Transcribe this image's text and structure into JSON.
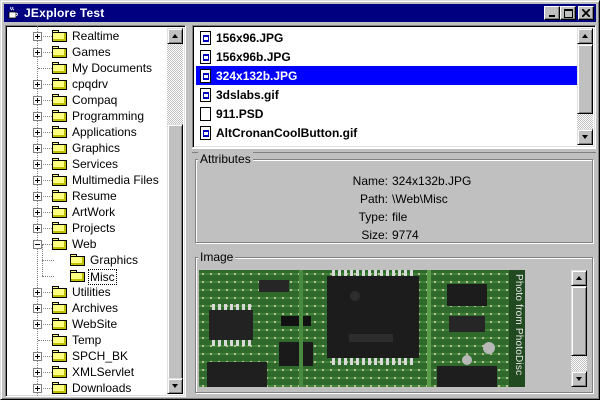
{
  "window": {
    "title": "JExplore Test"
  },
  "tree": {
    "items": [
      {
        "label": "Realtime",
        "expanded": false
      },
      {
        "label": "Games",
        "expanded": false
      },
      {
        "label": "My Documents",
        "expanded": null
      },
      {
        "label": "cpqdrv",
        "expanded": false
      },
      {
        "label": "Compaq",
        "expanded": false
      },
      {
        "label": "Programming",
        "expanded": false
      },
      {
        "label": "Applications",
        "expanded": false
      },
      {
        "label": "Graphics",
        "expanded": false
      },
      {
        "label": "Services",
        "expanded": false
      },
      {
        "label": "Multimedia Files",
        "expanded": false
      },
      {
        "label": "Resume",
        "expanded": false
      },
      {
        "label": "ArtWork",
        "expanded": false
      },
      {
        "label": "Projects",
        "expanded": false
      },
      {
        "label": "Web",
        "expanded": true
      },
      {
        "label": "Graphics",
        "expanded": null,
        "child": true
      },
      {
        "label": "Misc",
        "expanded": null,
        "child": true,
        "selected": true
      },
      {
        "label": "Utilities",
        "expanded": false
      },
      {
        "label": "Archives",
        "expanded": false
      },
      {
        "label": "WebSite",
        "expanded": false
      },
      {
        "label": "Temp",
        "expanded": null
      },
      {
        "label": "SPCH_BK",
        "expanded": false
      },
      {
        "label": "XMLServlet",
        "expanded": false
      },
      {
        "label": "Downloads",
        "expanded": false
      }
    ]
  },
  "files": {
    "items": [
      {
        "name": "156x96.JPG",
        "icon": "image-file-icon"
      },
      {
        "name": "156x96b.JPG",
        "icon": "image-file-icon"
      },
      {
        "name": "324x132b.JPG",
        "icon": "image-file-icon",
        "selected": true
      },
      {
        "name": "3dslabs.gif",
        "icon": "image-file-icon"
      },
      {
        "name": "911.PSD",
        "icon": "blank-file-icon"
      },
      {
        "name": "AltCronanCoolButton.gif",
        "icon": "image-file-icon"
      }
    ]
  },
  "attributes": {
    "title": "Attributes",
    "rows": [
      {
        "key": "Name:",
        "value": "324x132b.JPG"
      },
      {
        "key": "Path:",
        "value": "\\Web\\Misc"
      },
      {
        "key": "Type:",
        "value": "file"
      },
      {
        "key": "Size:",
        "value": "9774"
      }
    ]
  },
  "image_panel": {
    "title": "Image",
    "photo_credit": "Photo from PhotoDisc"
  },
  "colors": {
    "title_bar": "#000080",
    "selection": "#0000ff",
    "folder": "#ffff80",
    "pcb_green": "#2b5a2a"
  }
}
